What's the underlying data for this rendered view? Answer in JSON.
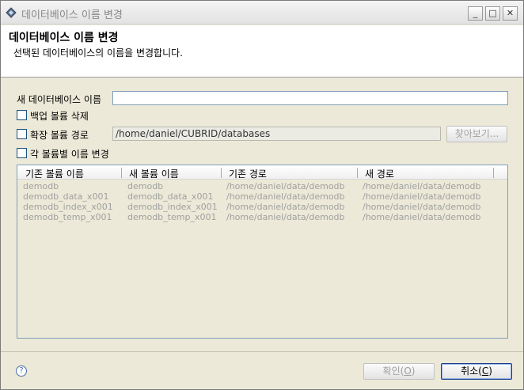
{
  "window": {
    "title": "데이터베이스 이름 변경",
    "minimize_glyph": "_",
    "maximize_glyph": "□",
    "close_glyph": "✕"
  },
  "banner": {
    "heading": "데이터베이스 이름 변경",
    "description": "선택된 데이터베이스의 이름을 변경합니다."
  },
  "form": {
    "new_name_label": "새 데이터베이스 이름",
    "new_name_value": "",
    "delete_backup_label": "백업 볼륨 삭제",
    "delete_backup_checked": false,
    "extend_volume_label": "확장 볼륨 경로",
    "extend_volume_checked": false,
    "extend_volume_path": "/home/daniel/CUBRID/databases",
    "browse_label": "찾아보기...",
    "rename_each_label": "각 볼륨별 이름 변경",
    "rename_each_checked": false
  },
  "table": {
    "columns": [
      "기존 볼륨 이름",
      "새 볼륨 이름",
      "기존 경로",
      "새 경로"
    ],
    "rows": [
      [
        "demodb",
        "demodb",
        "/home/daniel/data/demodb",
        "/home/daniel/data/demodb"
      ],
      [
        "demodb_data_x001",
        "demodb_data_x001",
        "/home/daniel/data/demodb",
        "/home/daniel/data/demodb"
      ],
      [
        "demodb_index_x001",
        "demodb_index_x001",
        "/home/daniel/data/demodb",
        "/home/daniel/data/demodb"
      ],
      [
        "demodb_temp_x001",
        "demodb_temp_x001",
        "/home/daniel/data/demodb",
        "/home/daniel/data/demodb"
      ]
    ]
  },
  "footer": {
    "help_glyph": "?",
    "ok_label": "확인",
    "ok_mnemonic": "O",
    "cancel_label": "취소",
    "cancel_mnemonic": "C"
  }
}
